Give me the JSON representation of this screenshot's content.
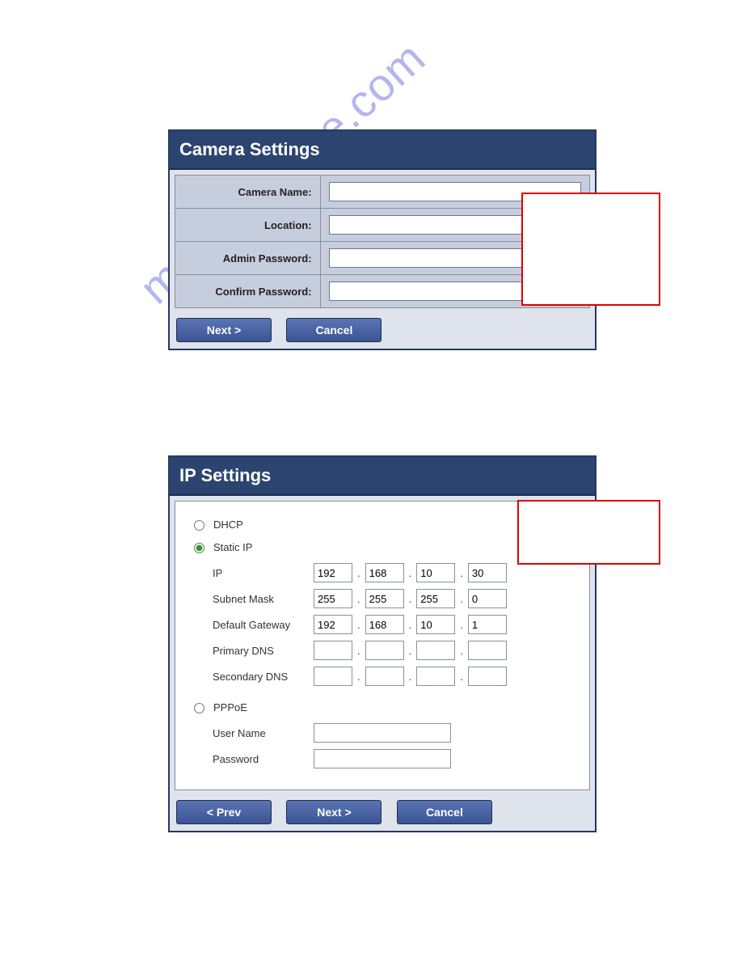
{
  "watermark": "manualshive.com",
  "camera": {
    "title": "Camera Settings",
    "labels": {
      "name": "Camera Name:",
      "location": "Location:",
      "admin_pw": "Admin Password:",
      "confirm_pw": "Confirm Password:"
    },
    "values": {
      "name": "",
      "location": "",
      "admin_pw": "",
      "confirm_pw": ""
    },
    "buttons": {
      "next": "Next >",
      "cancel": "Cancel"
    }
  },
  "ip": {
    "title": "IP Settings",
    "options": {
      "dhcp": "DHCP",
      "static": "Static IP",
      "pppoe": "PPPoE"
    },
    "selected": "static",
    "labels": {
      "ip": "IP",
      "mask": "Subnet Mask",
      "gateway": "Default Gateway",
      "pdns": "Primary DNS",
      "sdns": "Secondary DNS",
      "user": "User Name",
      "pass": "Password"
    },
    "ip_addr": [
      "192",
      "168",
      "10",
      "30"
    ],
    "subnet_mask": [
      "255",
      "255",
      "255",
      "0"
    ],
    "gateway": [
      "192",
      "168",
      "10",
      "1"
    ],
    "primary_dns": [
      "",
      "",
      "",
      ""
    ],
    "secondary_dns": [
      "",
      "",
      "",
      ""
    ],
    "pppoe": {
      "user": "",
      "pass": ""
    },
    "buttons": {
      "prev": "< Prev",
      "next": "Next >",
      "cancel": "Cancel"
    }
  }
}
